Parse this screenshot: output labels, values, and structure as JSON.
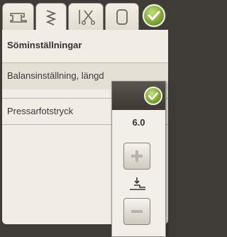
{
  "tabs": [
    {
      "icon": "sewing-machine-icon"
    },
    {
      "icon": "stitch-zigzag-icon",
      "active": true
    },
    {
      "icon": "scissors-needle-icon"
    },
    {
      "icon": "frame-icon"
    },
    {
      "icon": "checkmark-icon"
    }
  ],
  "page": {
    "title": "Söminställningar",
    "rows": [
      {
        "label": "Balansinställning, längd"
      },
      {
        "label": "Pressarfotstryck"
      }
    ]
  },
  "popup": {
    "value": "6.0",
    "confirm_icon": "checkmark-icon",
    "increase_icon": "plus-icon",
    "decrease_icon": "minus-icon",
    "indicator_icon": "presser-foot-pressure-icon"
  },
  "colors": {
    "accent_green": "#7aa32a",
    "background": "#f1ede5",
    "frame": "#3f3b36"
  }
}
